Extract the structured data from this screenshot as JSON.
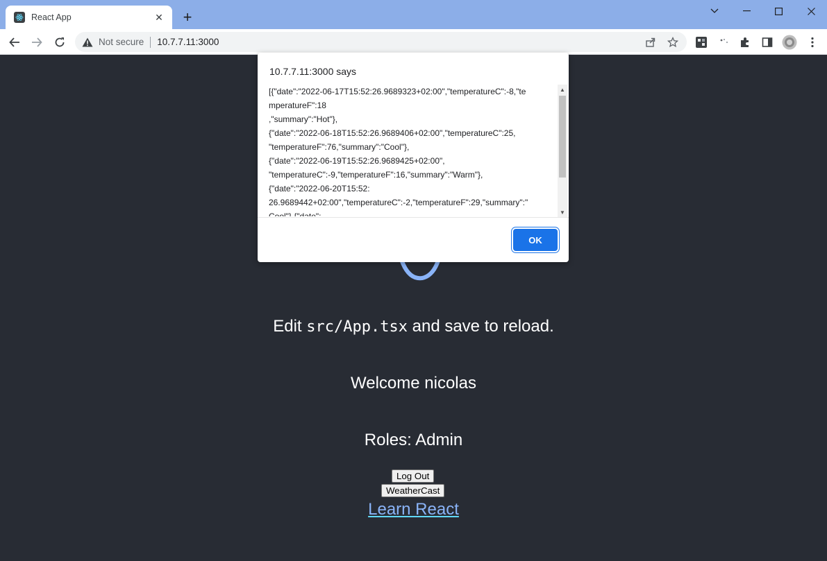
{
  "browser": {
    "tab_title": "React App",
    "new_tab_label": "+",
    "tab_close_label": "✕",
    "security_label": "Not secure",
    "url": "10.7.7.11:3000"
  },
  "page": {
    "edit_prefix": "Edit ",
    "edit_code": "src/App.tsx",
    "edit_suffix": " and save to reload.",
    "welcome": "Welcome nicolas",
    "roles": "Roles: Admin",
    "logout_label": "Log Out",
    "weathercast_label": "WeatherCast",
    "learn_link": "Learn React"
  },
  "dialog": {
    "title": "10.7.7.11:3000 says",
    "message_lines": [
      "[{\"date\":\"2022-06-17T15:52:26.9689323+02:00\",\"temperatureC\":-8,\"te",
      "mperatureF\":18",
      ",\"summary\":\"Hot\"},",
      "{\"date\":\"2022-06-18T15:52:26.9689406+02:00\",\"temperatureC\":25,",
      "\"temperatureF\":76,\"summary\":\"Cool\"},",
      "{\"date\":\"2022-06-19T15:52:26.9689425+02:00\",",
      "\"temperatureC\":-9,\"temperatureF\":16,\"summary\":\"Warm\"},",
      "{\"date\":\"2022-06-20T15:52:",
      "26.9689442+02:00\",\"temperatureC\":-2,\"temperatureF\":29,\"summary\":\"",
      "Cool\"},{\"date\":"
    ],
    "ok_label": "OK"
  },
  "colors": {
    "page_bg": "#282c34",
    "titlebar": "#8caee8",
    "ok_button": "#1a73e8",
    "link": "#8ab4f8"
  },
  "icons": [
    "react-favicon-icon",
    "close-icon",
    "plus-icon",
    "minimize-icon",
    "maximize-icon",
    "chevron-down-icon",
    "back-icon",
    "forward-icon",
    "reload-icon",
    "warning-icon",
    "share-icon",
    "star-icon",
    "extension-icon",
    "puzzle-icon",
    "sidepanel-icon",
    "avatar",
    "more-icon"
  ]
}
